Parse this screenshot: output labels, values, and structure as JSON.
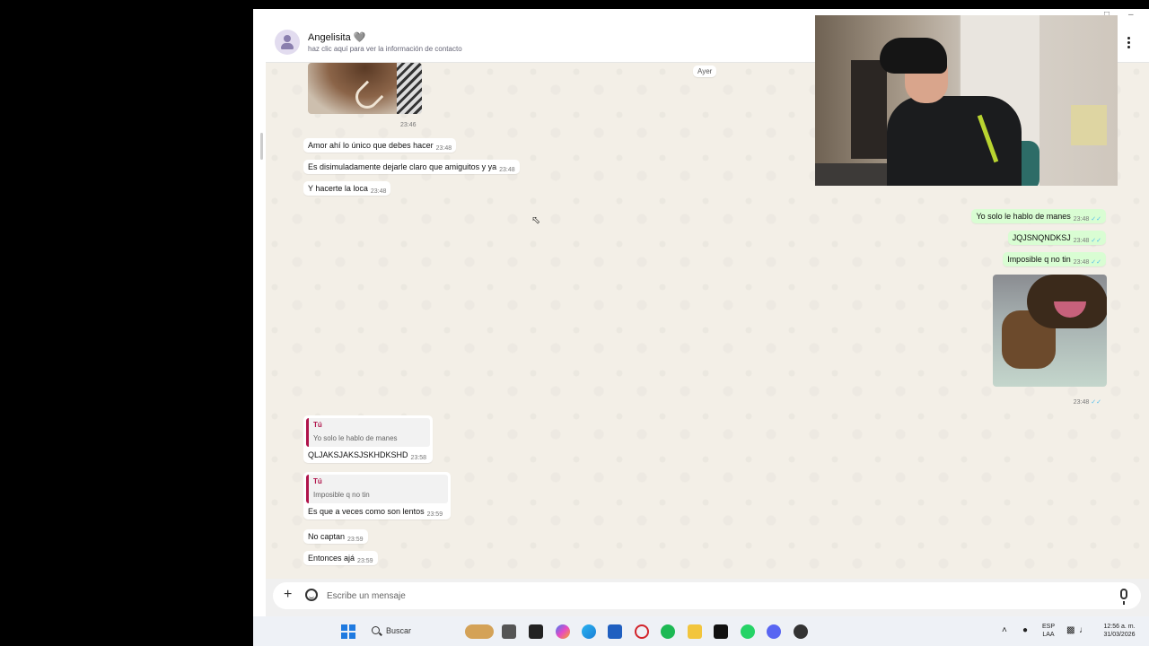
{
  "window": {
    "minimize_glyph": "–",
    "maximize_glyph": "□"
  },
  "header": {
    "contact_name": "Angelisita 🩶",
    "contact_subtitle": "haz clic aquí para ver la información de contacto"
  },
  "chat": {
    "date_separator": "Ayer",
    "incoming_top": [
      {
        "text": "Amor ahí lo único que debes hacer",
        "time": "23:48"
      },
      {
        "text": "Es disimuladamente dejarle claro que amiguitos y ya",
        "time": "23:48"
      },
      {
        "text": "Y hacerte la loca",
        "time": "23:48"
      }
    ],
    "image_time": "23:46",
    "outgoing": [
      {
        "text": "Yo solo le hablo de manes",
        "time": "23:48",
        "ticks": "✓✓"
      },
      {
        "text": "JQJSNQNDKSJ",
        "time": "23:48",
        "ticks": "✓✓"
      },
      {
        "text": "Imposible q no tin",
        "time": "23:48",
        "ticks": "✓✓"
      }
    ],
    "outgoing_image": {
      "time": "23:48",
      "ticks": "✓✓"
    },
    "replies": [
      {
        "author": "Tú",
        "quoted": "Yo solo le hablo de manes",
        "text": "QLJAKSJAKSJSKHDKSHD",
        "time": "23:58"
      },
      {
        "author": "Tú",
        "quoted": "Imposible q no tin",
        "text": "Es que a veces como son lentos",
        "time": "23:59"
      }
    ],
    "incoming_bottom": [
      {
        "text": "No captan",
        "time": "23:59"
      },
      {
        "text": "Entonces ajá",
        "time": "23:59"
      }
    ]
  },
  "composer": {
    "plus": "+",
    "placeholder": "Escribe un mensaje"
  },
  "taskbar": {
    "search_label": "Buscar",
    "language": "ESP",
    "layout": "LAA",
    "time": "12:56 a. m.",
    "date": "31/03/2026",
    "chevron": "˄"
  },
  "colors": {
    "outgoing_bubble": "#d9fdd3",
    "reply_accent": "#b0134a",
    "read_ticks": "#53bdeb"
  }
}
